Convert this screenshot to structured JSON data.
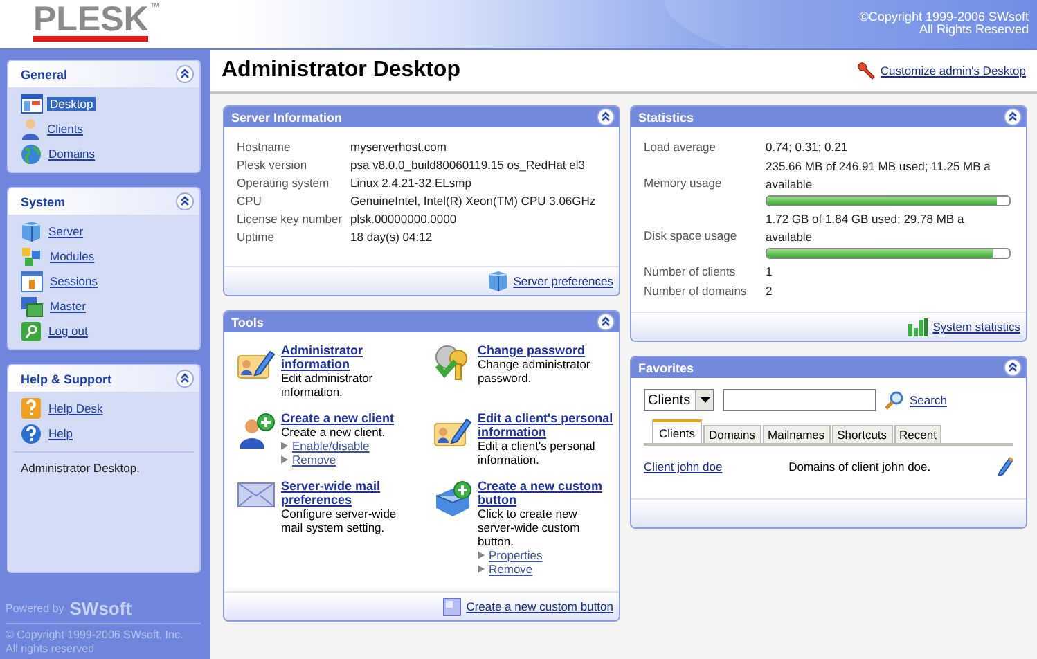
{
  "header": {
    "logo": "PLESK",
    "trademark": "™",
    "copyright": [
      "©Copyright 1999-2006 SWsoft",
      "All Rights Reserved"
    ]
  },
  "sidebar": {
    "sections": [
      {
        "title": "General",
        "items": [
          {
            "label": "Desktop",
            "selected": true
          },
          {
            "label": "Clients",
            "selected": false
          },
          {
            "label": "Domains",
            "selected": false
          }
        ]
      },
      {
        "title": "System",
        "items": [
          {
            "label": "Server",
            "selected": false
          },
          {
            "label": "Modules",
            "selected": false
          },
          {
            "label": "Sessions",
            "selected": false
          },
          {
            "label": "Master",
            "selected": false
          },
          {
            "label": "Log out",
            "selected": false
          }
        ]
      },
      {
        "title": "Help & Support",
        "items": [
          {
            "label": "Help Desk",
            "selected": false
          },
          {
            "label": "Help",
            "selected": false
          }
        ],
        "description": "Administrator Desktop."
      }
    ],
    "powered_by": "Powered by",
    "vendor": "SWsoft",
    "copyright": [
      "© Copyright 1999-2006 SWsoft, Inc.",
      "All rights reserved"
    ]
  },
  "page": {
    "title": "Administrator Desktop",
    "customize_link": "Customize admin's Desktop"
  },
  "server_information": {
    "title": "Server Information",
    "rows": [
      {
        "label": "Hostname",
        "value": "myserverhost.com"
      },
      {
        "label": "Plesk version",
        "value": "psa v8.0.0_build80060119.15 os_RedHat el3"
      },
      {
        "label": "Operating system",
        "value": "Linux 2.4.21-32.ELsmp"
      },
      {
        "label": "CPU",
        "value": "GenuineIntel, Intel(R) Xeon(TM) CPU 3.06GHz"
      },
      {
        "label": "License key number",
        "value": "plsk.00000000.0000"
      },
      {
        "label": "Uptime",
        "value": "18 day(s) 04:12"
      }
    ],
    "footer_link": "Server preferences"
  },
  "tools": {
    "title": "Tools",
    "items": [
      {
        "title": "Administrator information",
        "description": "Edit administrator information."
      },
      {
        "title": "Change password",
        "description": "Change administrator password."
      },
      {
        "title": "Create a new client",
        "description": "Create a new client.",
        "links": [
          "Enable/disable",
          "Remove"
        ]
      },
      {
        "title": "Edit a client's personal information",
        "description": "Edit a client's personal information."
      },
      {
        "title": "Server-wide mail preferences",
        "description": "Configure server-wide mail system setting."
      },
      {
        "title": "Create a new custom button",
        "description": "Click to create new server-wide custom button.",
        "links": [
          "Properties",
          "Remove"
        ]
      }
    ],
    "footer_link": "Create a new custom button"
  },
  "statistics": {
    "title": "Statistics",
    "rows": [
      {
        "kind": "text",
        "label": "Load average",
        "value": "0.74; 0.31; 0.21"
      },
      {
        "kind": "meter",
        "label": "Memory usage",
        "value": "235.66 MB of 246.91 MB used; 11.25 MB a available",
        "level": 0.95
      },
      {
        "kind": "meter",
        "label": "Disk space usage",
        "value": "1.72 GB of 1.84 GB used; 29.78 MB a available",
        "level": 0.93
      },
      {
        "kind": "text",
        "label": "Number of clients",
        "value": "1"
      },
      {
        "kind": "text",
        "label": "Number of domains",
        "value": "2"
      }
    ],
    "footer_link": "System statistics"
  },
  "favorites": {
    "title": "Favorites",
    "select": "Clients",
    "search_button": "Search",
    "tabs": [
      {
        "label": "Clients",
        "selected": true
      },
      {
        "label": "Domains",
        "selected": false
      },
      {
        "label": "Mailnames",
        "selected": false
      },
      {
        "label": "Shortcuts",
        "selected": false
      },
      {
        "label": "Recent",
        "selected": false
      }
    ],
    "rows": [
      {
        "name": "Client john doe",
        "description": "Domains of client john doe."
      }
    ]
  }
}
